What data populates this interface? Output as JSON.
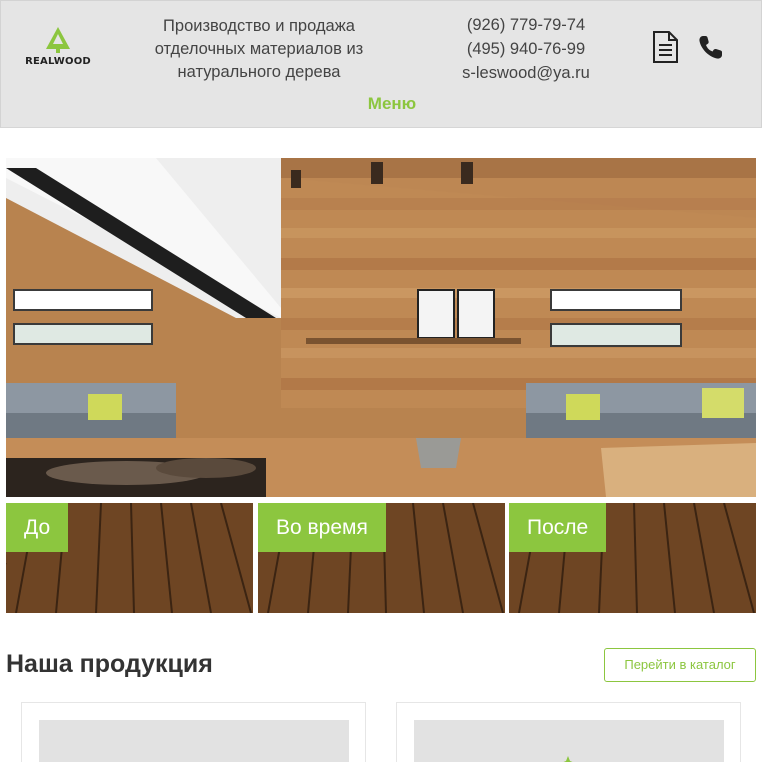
{
  "header": {
    "logo_text": "REALWOOD",
    "tagline": "Производство и продажа отделочных материалов из натурального дерева",
    "phone_1": "(926) 779-79-74",
    "phone_2": "(495) 940-76-99",
    "email": "s-leswood@ya.ru",
    "menu_label": "Меню",
    "icons": [
      "document-icon",
      "phone-icon"
    ]
  },
  "stages": [
    {
      "label": "До"
    },
    {
      "label": "Во время"
    },
    {
      "label": "После"
    }
  ],
  "products": {
    "title": "Наша продукция",
    "catalog_button": "Перейти в каталог"
  },
  "colors": {
    "accent": "#8cc63f",
    "header_bg": "#e5e5e5",
    "text": "#333333"
  }
}
